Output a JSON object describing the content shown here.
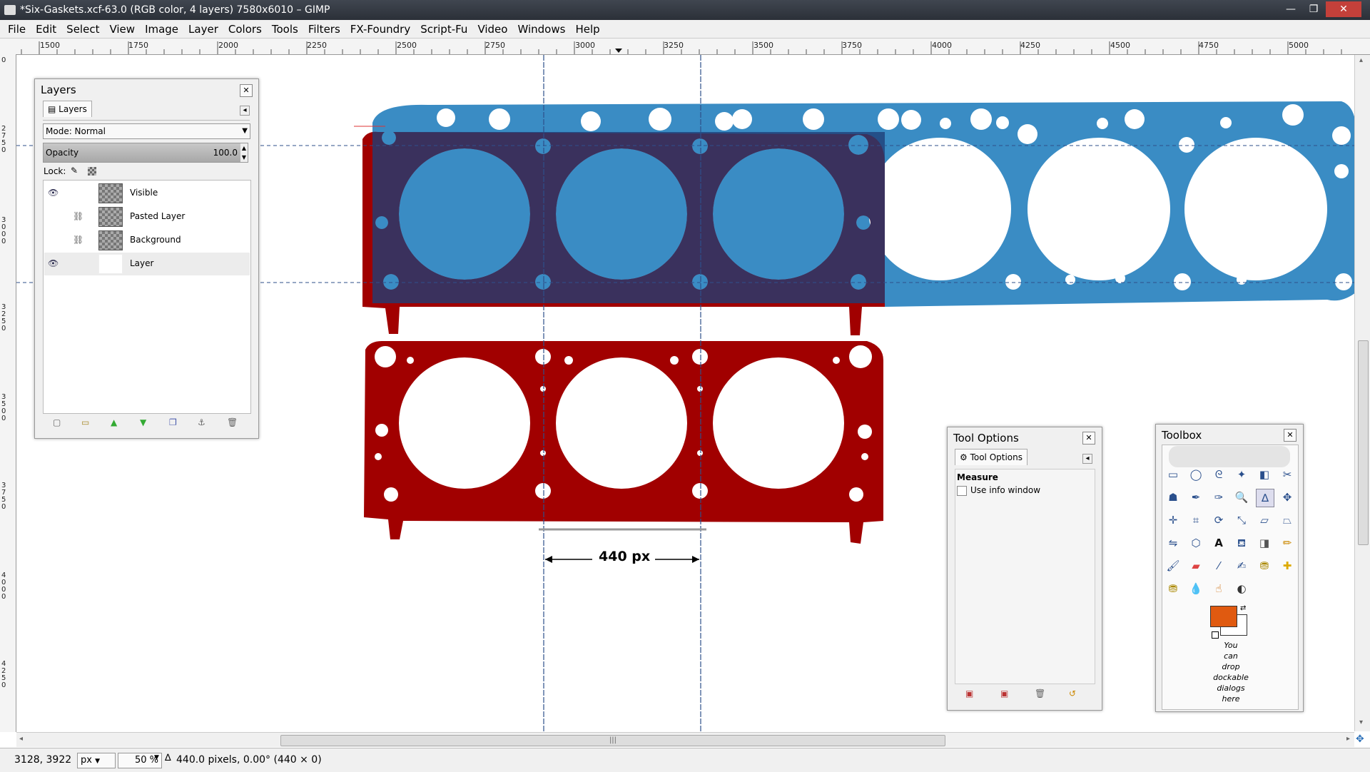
{
  "window": {
    "title": "*Six-Gaskets.xcf-63.0 (RGB color, 4 layers) 7580x6010 – GIMP",
    "minimize": "—",
    "maximize": "❐",
    "close": "✕"
  },
  "menu": [
    "File",
    "Edit",
    "Select",
    "View",
    "Image",
    "Layer",
    "Colors",
    "Tools",
    "Filters",
    "FX-Foundry",
    "Script-Fu",
    "Video",
    "Windows",
    "Help"
  ],
  "ruler": {
    "h_labels": [
      "1500",
      "1750",
      "2000",
      "2250",
      "2500",
      "2750",
      "3000",
      "3250",
      "3500",
      "3750",
      "4000",
      "4250",
      "4500",
      "4750",
      "5000"
    ],
    "v_labels": [
      "0",
      "2750",
      "3000",
      "3250",
      "3500",
      "3750",
      "4000",
      "4250"
    ]
  },
  "canvas": {
    "measure_label": "440 px",
    "colors": {
      "red": "#a10000",
      "blue": "#3a8cc4",
      "overlay": "#2e4a7a"
    }
  },
  "layers_dialog": {
    "title": "Layers",
    "tab": "Layers",
    "mode_label": "Mode: Normal",
    "opacity_label": "Opacity",
    "opacity_value": "100.0",
    "lock_label": "Lock:",
    "layers": [
      {
        "name": "Visible",
        "eye": true,
        "chain": false,
        "thumb": true
      },
      {
        "name": "Pasted Layer",
        "eye": false,
        "chain": true,
        "thumb": true
      },
      {
        "name": "Background",
        "eye": false,
        "chain": true,
        "thumb": true
      },
      {
        "name": "Layer",
        "eye": true,
        "chain": false,
        "thumb": false
      }
    ]
  },
  "tool_options": {
    "title": "Tool Options",
    "tab": "Tool Options",
    "heading": "Measure",
    "checkbox_label": "Use info window"
  },
  "toolbox": {
    "title": "Toolbox",
    "fg_color": "#e05a10",
    "bg_color": "#ffffff",
    "drop_hint": [
      "You",
      "can",
      "drop",
      "dockable",
      "dialogs",
      "here"
    ]
  },
  "statusbar": {
    "coords": "3128, 3922",
    "unit": "px",
    "zoom": "50 %",
    "message": "440.0 pixels, 0.00° (440 × 0)"
  }
}
